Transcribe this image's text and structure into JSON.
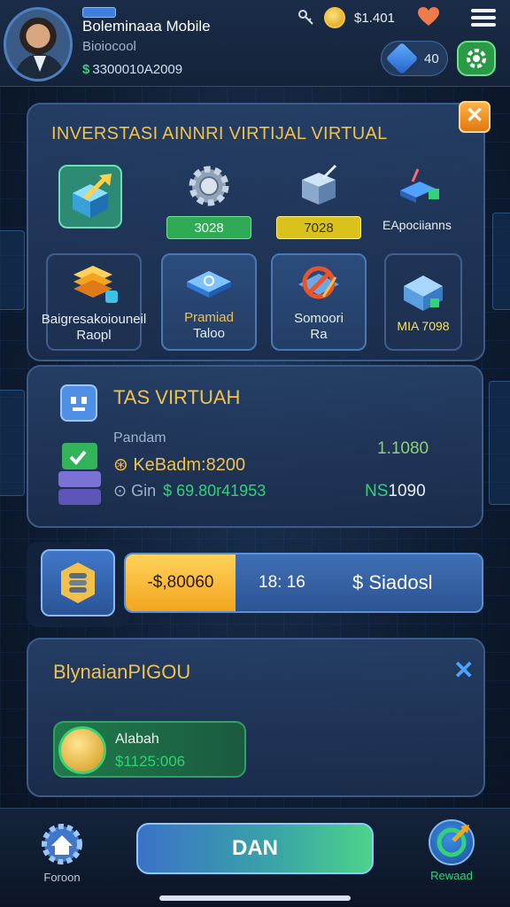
{
  "header": {
    "name": "Boleminaaa Mobile",
    "subtitle": "Bioiocool",
    "balance": "3300010A2009",
    "balance_currency": "$",
    "coin_value": "$1.401",
    "gem_value": "40"
  },
  "panel_invest": {
    "title": "INVERSTASI AINNRI VIRTIJAL VIRTUAL",
    "tiles": [
      {
        "icon": "cube-growth-icon",
        "value": ""
      },
      {
        "icon": "gear-icon",
        "value": "3028"
      },
      {
        "icon": "box-tools-icon",
        "value": "7028"
      },
      {
        "icon": "blue-book-icon",
        "value": "EApociianns"
      }
    ],
    "cards": [
      {
        "icon": "stack-money-icon",
        "line1": "Baigresakoiouneil",
        "line2": "Raopl"
      },
      {
        "icon": "blue-tag-icon",
        "line1": "Pramiad",
        "line2": "Taloo"
      },
      {
        "icon": "no-sign-icon",
        "line1": "Somoori",
        "line2": "Ra"
      },
      {
        "icon": "house-icon",
        "line1": "MIA 7098",
        "line2": ""
      }
    ]
  },
  "panel_virtual": {
    "title": "TAS VIRTUAH",
    "label": "Pandam",
    "coin_line": "KeBadm:8200",
    "gin_label": "Gin",
    "gin_value": "$ 69.80r41953",
    "right_value_1": "1.1080",
    "right_value_2_prefix": "NS",
    "right_value_2": "1090"
  },
  "action_bar": {
    "left_value": "-$,80060",
    "mid_value": "18: 16",
    "right_value": "$ Siadosl"
  },
  "panel_bonus": {
    "title": "BlynaianPIGOU",
    "reward_label": "Alabah",
    "reward_value": "$1125:006"
  },
  "bottom_nav": {
    "home_label": "Foroon",
    "main_button": "DAN",
    "reward_label": "Rewaad"
  },
  "colors": {
    "accent_gold": "#f1c24b",
    "accent_green": "#33d17a",
    "accent_blue": "#3f78c9",
    "accent_orange": "#f2a51e"
  }
}
